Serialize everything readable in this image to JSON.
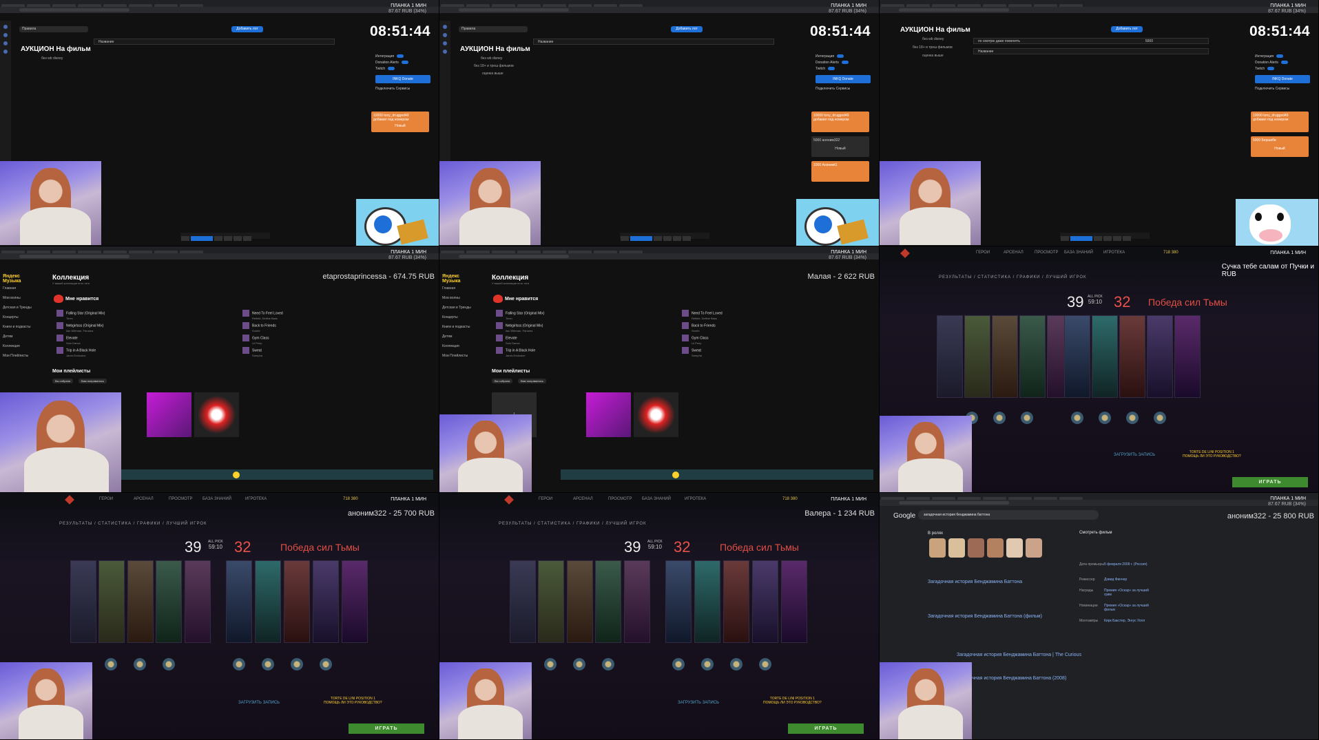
{
  "overlay": {
    "planka": "ПЛАНКА 1 МИН",
    "planka_sub": "87.67 RUB (34%)",
    "clock": "08:51:44"
  },
  "auction": {
    "title": "АУКЦИОН На фильм",
    "line1": "без wb disney",
    "line2": "без 18+ и треш фильмов",
    "line3": "оценка выше",
    "search_value": "Правила",
    "add_button": "Добавить лот",
    "lot_placeholder": "Название",
    "lot_1": "по смотрю даже поменять",
    "lot_1_value": "5000",
    "integration": "Интеграция",
    "donation_alerts": "Donation Alerts",
    "twitch": "Twitch",
    "inkq": "INKQ Donate",
    "subscribe": "Подключить Сервисы",
    "donation_1": "10000 tony_drugged49",
    "donation_1b": "добавил под номером",
    "donation_2": "5000 аноним322",
    "donation_3": "1000 Анонимt1",
    "donation_cow": "5000 Бершибв",
    "new_btn": "Новый"
  },
  "music": {
    "logo": "Яндекс Музыка",
    "nav": [
      "Главная",
      "Мои волны",
      "Детская и Тренды",
      "Концерты",
      "Книги и подкасты",
      "Детям",
      "Коллекция",
      "Мои Плейлисты"
    ],
    "header": "Коллекция",
    "header_sub": "У вашей коллекции есть тэги",
    "fav": "Мне нравится",
    "fav_count": "287 треков",
    "tracks_left": [
      {
        "title": "Falling Star (Original Mix)",
        "artist": "Тегги"
      },
      {
        "title": "Nebgirlsss (Original Mix)",
        "artist": "Ilan Wittman, Panama"
      },
      {
        "title": "Elevate",
        "artist": "Solo Dance"
      },
      {
        "title": "Trip in A Black Hole",
        "artist": "Jarvis Exclusive"
      }
    ],
    "tracks_right": [
      {
        "title": "Need To Feel Loved",
        "artist": "Reflekt, Delline Bass"
      },
      {
        "title": "Back to Friends",
        "artist": "Sombr"
      },
      {
        "title": "Gym Class",
        "artist": "Lil Peep"
      },
      {
        "title": "Sweat",
        "artist": "Sampha"
      }
    ],
    "playlists": "Мои плейлисты",
    "pl_btn1": "Вы собрали",
    "pl_btn2": "Вам понравились",
    "donate_left": "etaprostaprincessa - 674.75 RUB",
    "donate_right": "Малая - 2 622 RUB"
  },
  "dota": {
    "nav": [
      "ГЕРОИ",
      "АРСЕНАЛ",
      "ПРОСМОТР",
      "БАЗА ЗНАНИЙ",
      "ИГРОТЕКА"
    ],
    "tabs": "РЕЗУЛЬТАТЫ / СТАТИСТИКА / ГРАФИКИ / ЛУЧШИЙ ИГРОК",
    "score_left": "39",
    "score_right": "32",
    "all_pick": "ALL PICK",
    "duration": "59:10",
    "victory": "Победа сил Тьмы",
    "play": "ИГРАТЬ",
    "record": "ЗАГРУЗИТЬ ЗАПИСЬ",
    "wins": "TORTE DE LINI POSITION 1",
    "help": "ПОМОЩЬ ЛИ ЭТО РУКОВОДСТВО?",
    "donate_1": "аноним322 - 25 700 RUB",
    "donate_2": "Валера - 1 234 RUB",
    "donate_3": "Сучка тебе салам от Пучки и",
    "donate_3b": "RUB",
    "gold": "718 380"
  },
  "google": {
    "logo": "Google",
    "query": "загадочная история бенджамина баттона",
    "roles": "В ролях",
    "result1_title": "Загадочная история Бенджамина Баттона",
    "result2_title": "Загадочная история Бенджамина Баттона (фильм)",
    "result3_title": "Загадочная история Бенджамина Баттона (2008)",
    "result4_title": "Загадочная история Бенджамина Баттона | The Curious",
    "watch": "Смотреть фильм",
    "facts": [
      {
        "k": "Дата премьеры",
        "v": "5 февраля 2009 г. (Россия)"
      },
      {
        "k": "Режиссер",
        "v": "Дэвид Финчер"
      },
      {
        "k": "Награды",
        "v": "Премия «Оскар» за лучший грим"
      },
      {
        "k": "Номинации",
        "v": "Премия «Оскар» за лучший фильм"
      },
      {
        "k": "Монтажёры",
        "v": "Кирк Бакстер, Энгус Уолл"
      }
    ],
    "donate": "аноним322 - 25 800 RUB"
  }
}
